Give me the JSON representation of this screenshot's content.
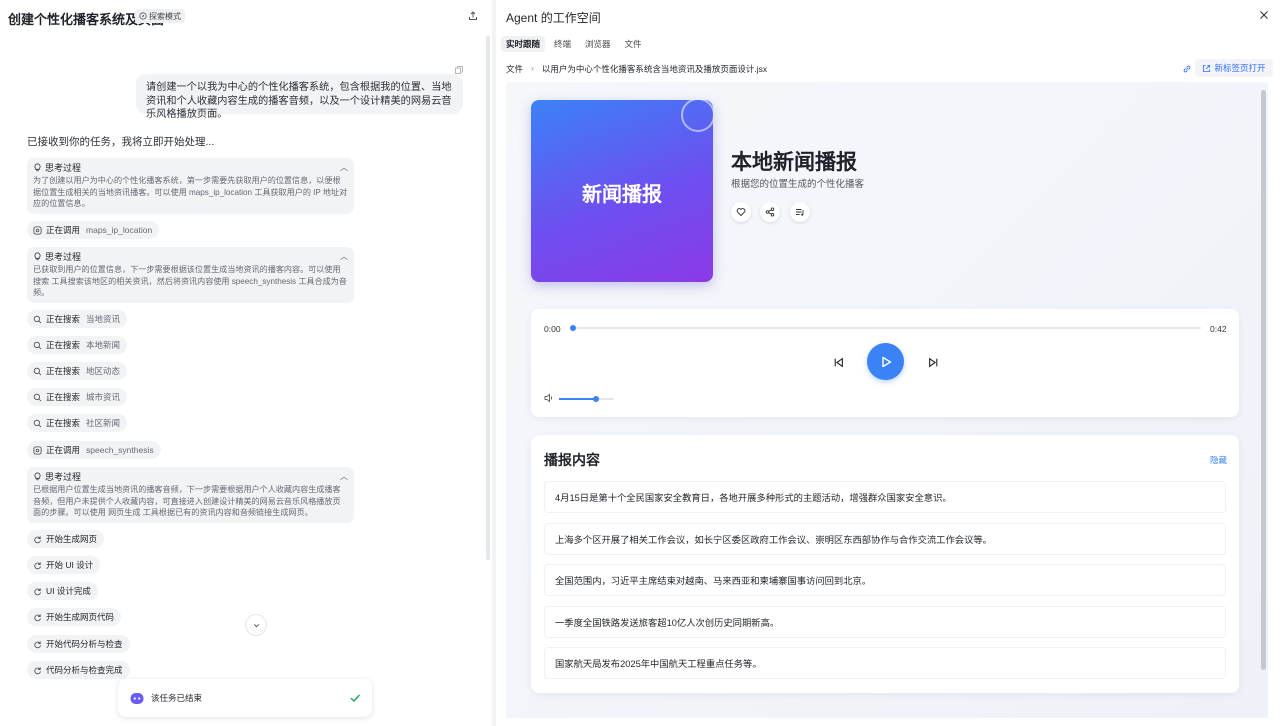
{
  "left": {
    "title": "创建个性化播客系统及页面",
    "mode_badge": "探索模式",
    "user_message": "请创建一个以我为中心的个性化播客系统，包含根据我的位置、当地资讯和个人收藏内容生成的播客音频，以及一个设计精美的网易云音乐风格播放页面。",
    "ack": "已接收到你的任务，我将立即开始处理...",
    "thinking": [
      {
        "label": "思考过程",
        "text": "为了创建以用户为中心的个性化播客系统，第一步需要先获取用户的位置信息，以便根据位置生成相关的当地资讯播客。可以使用 maps_ip_location 工具获取用户的 IP 地址对应的位置信息。"
      },
      {
        "label": "思考过程",
        "text": "已获取到用户的位置信息，下一步需要根据该位置生成当地资讯的播客内容。可以使用 搜索 工具搜索该地区的相关资讯，然后将资讯内容使用 speech_synthesis 工具合成为音频。"
      },
      {
        "label": "思考过程",
        "text": "已根据用户位置生成当地资讯的播客音频，下一步需要根据用户个人收藏内容生成播客音频，但用户未提供个人收藏内容，可直接进入创建设计精美的网易云音乐风格播放页面的步骤。可以使用 网页生成 工具根据已有的资讯内容和音频链接生成网页。"
      }
    ],
    "calls": [
      {
        "action": "正在调用",
        "arg": "maps_ip_location"
      },
      {
        "action": "正在调用",
        "arg": "speech_synthesis"
      }
    ],
    "searches": [
      {
        "action": "正在搜索",
        "arg": "当地资讯"
      },
      {
        "action": "正在搜索",
        "arg": "本地新闻"
      },
      {
        "action": "正在搜索",
        "arg": "地区动态"
      },
      {
        "action": "正在搜索",
        "arg": "城市资讯"
      },
      {
        "action": "正在搜索",
        "arg": "社区新闻"
      }
    ],
    "steps": [
      "开始生成网页",
      "开始 UI 设计",
      "UI 设计完成",
      "开始生成网页代码",
      "开始代码分析与检查",
      "代码分析与检查完成"
    ],
    "done_text": "该任务已结束"
  },
  "right": {
    "title": "Agent 的工作空间",
    "tabs": [
      "实时跟随",
      "终端",
      "浏览器",
      "文件"
    ],
    "breadcrumb": {
      "root": "文件",
      "file": "以用户为中心个性化播客系统含当地资讯及播放页面设计.jsx"
    },
    "open_new_tab": "新标签页打开",
    "preview": {
      "cover_text": "新闻播报",
      "episode_title": "本地新闻播报",
      "episode_subtitle": "根据您的位置生成的个性化播客",
      "time_current": "0:00",
      "time_total": "0:42",
      "progress": 0.0,
      "volume": 0.68,
      "content_title": "播报内容",
      "hide_label": "隐藏",
      "news": [
        "4月15日是第十个全民国家安全教育日，各地开展多种形式的主题活动，增强群众国家安全意识。",
        "上海多个区开展了相关工作会议，如长宁区委区政府工作会议、崇明区东西部协作与合作交流工作会议等。",
        "全国范围内，习近平主席结束对越南、马来西亚和柬埔寨国事访问回到北京。",
        "一季度全国铁路发送旅客超10亿人次创历史同期新高。",
        "国家航天局发布2025年中国航天工程重点任务等。"
      ],
      "accent": "#3b82f6"
    }
  }
}
